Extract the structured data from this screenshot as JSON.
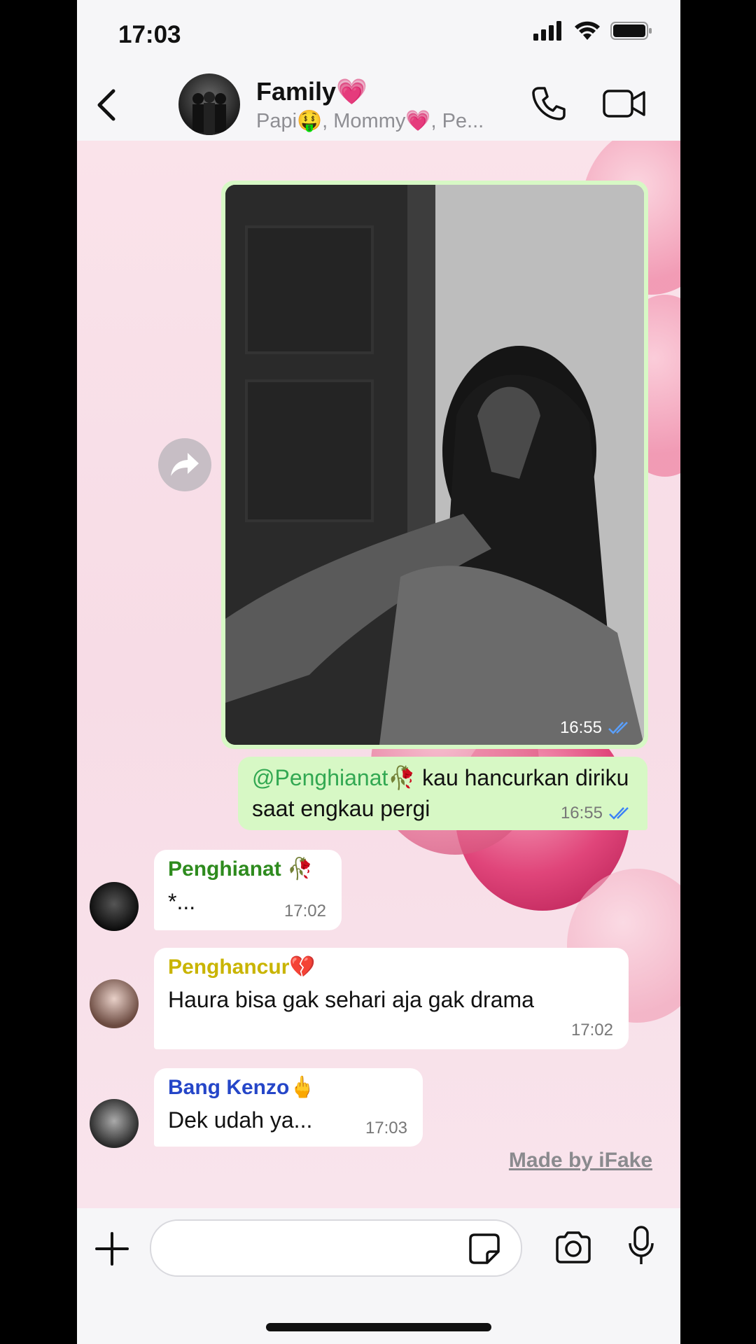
{
  "status_bar": {
    "time": "17:03"
  },
  "header": {
    "title": "Family💗",
    "subtitle": "Papi🤑, Mommy💗, Pe..."
  },
  "messages": {
    "image": {
      "time": "16:55"
    },
    "outgoing": {
      "mention": "@Penghianat🥀",
      "text": " kau hancurkan diriku saat engkau pergi",
      "time": "16:55"
    },
    "incoming": [
      {
        "sender": "Penghianat 🥀",
        "sender_color": "#2e8b1e",
        "text": "*...",
        "time": "17:02"
      },
      {
        "sender": "Penghancur💔",
        "sender_color": "#c9b400",
        "text": "Haura bisa gak sehari aja gak drama",
        "time": "17:02"
      },
      {
        "sender": "Bang Kenzo🖕",
        "sender_color": "#2546c8",
        "text": "Dek udah ya...",
        "time": "17:03"
      }
    ]
  },
  "watermark": "Made by iFake",
  "colors": {
    "outgoing_bubble": "#d7f8c5",
    "read_ticks": "#3b82f6",
    "incoming_bubble": "#ffffff"
  }
}
